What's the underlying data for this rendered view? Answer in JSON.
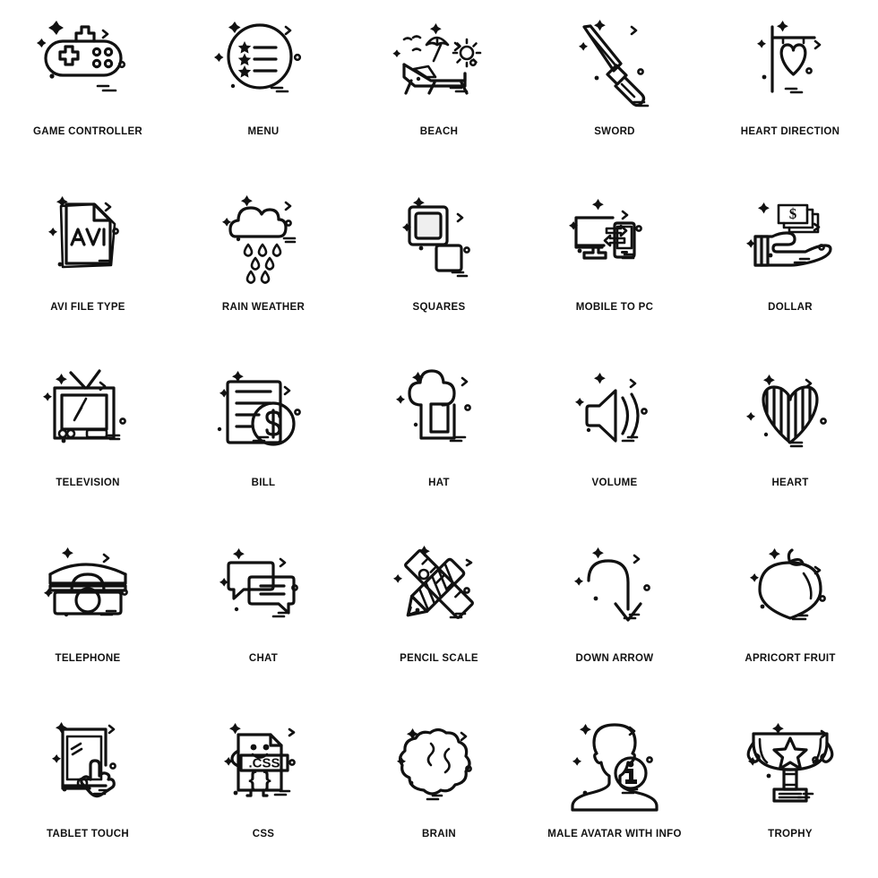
{
  "page": {
    "title": "Icon Set Sheet",
    "background_color": "#ffffff",
    "stroke_color": "#111111",
    "columns": 5,
    "rows": 5,
    "total_icons": 25
  },
  "icons": [
    {
      "id": "game-controller",
      "label": "GAME CONTROLLER",
      "row": 1,
      "col": 1
    },
    {
      "id": "menu",
      "label": "MENU",
      "row": 1,
      "col": 2
    },
    {
      "id": "beach",
      "label": "BEACH",
      "row": 1,
      "col": 3
    },
    {
      "id": "sword",
      "label": "SWORD",
      "row": 1,
      "col": 4
    },
    {
      "id": "heart-direction",
      "label": "HEART DIRECTION",
      "row": 1,
      "col": 5
    },
    {
      "id": "avi-file-type",
      "label": "AVI FILE TYPE",
      "row": 2,
      "col": 1,
      "glyph_text": "AVI"
    },
    {
      "id": "rain-weather",
      "label": "RAIN WEATHER",
      "row": 2,
      "col": 2
    },
    {
      "id": "squares",
      "label": "SQUARES",
      "row": 2,
      "col": 3
    },
    {
      "id": "mobile-to-pc",
      "label": "MOBILE TO PC",
      "row": 2,
      "col": 4
    },
    {
      "id": "dollar",
      "label": "DOLLAR",
      "row": 2,
      "col": 5,
      "glyph_text": "$"
    },
    {
      "id": "television",
      "label": "TELEVISION",
      "row": 3,
      "col": 1
    },
    {
      "id": "bill",
      "label": "BILL",
      "row": 3,
      "col": 2,
      "glyph_text": "$"
    },
    {
      "id": "hat",
      "label": "HAT",
      "row": 3,
      "col": 3
    },
    {
      "id": "volume",
      "label": "VOLUME",
      "row": 3,
      "col": 4
    },
    {
      "id": "heart",
      "label": "HEART",
      "row": 3,
      "col": 5
    },
    {
      "id": "telephone",
      "label": "TELEPHONE",
      "row": 4,
      "col": 1
    },
    {
      "id": "chat",
      "label": "CHAT",
      "row": 4,
      "col": 2
    },
    {
      "id": "pencil-scale",
      "label": "PENCIL SCALE",
      "row": 4,
      "col": 3
    },
    {
      "id": "down-arrow",
      "label": "DOWN ARROW",
      "row": 4,
      "col": 4
    },
    {
      "id": "apricort-fruit",
      "label": "APRICORT FRUIT",
      "row": 4,
      "col": 5
    },
    {
      "id": "tablet-touch",
      "label": "TABLET TOUCH",
      "row": 5,
      "col": 1
    },
    {
      "id": "css",
      "label": "CSS",
      "row": 5,
      "col": 2,
      "glyph_text": ".CSS",
      "glyph_text2": "{ }"
    },
    {
      "id": "brain",
      "label": "BRAIN",
      "row": 5,
      "col": 3
    },
    {
      "id": "male-avatar-with-info",
      "label": "MALE AVATAR WITH INFO",
      "row": 5,
      "col": 4,
      "glyph_text": "i"
    },
    {
      "id": "trophy",
      "label": "TROPHY",
      "row": 5,
      "col": 5
    }
  ]
}
